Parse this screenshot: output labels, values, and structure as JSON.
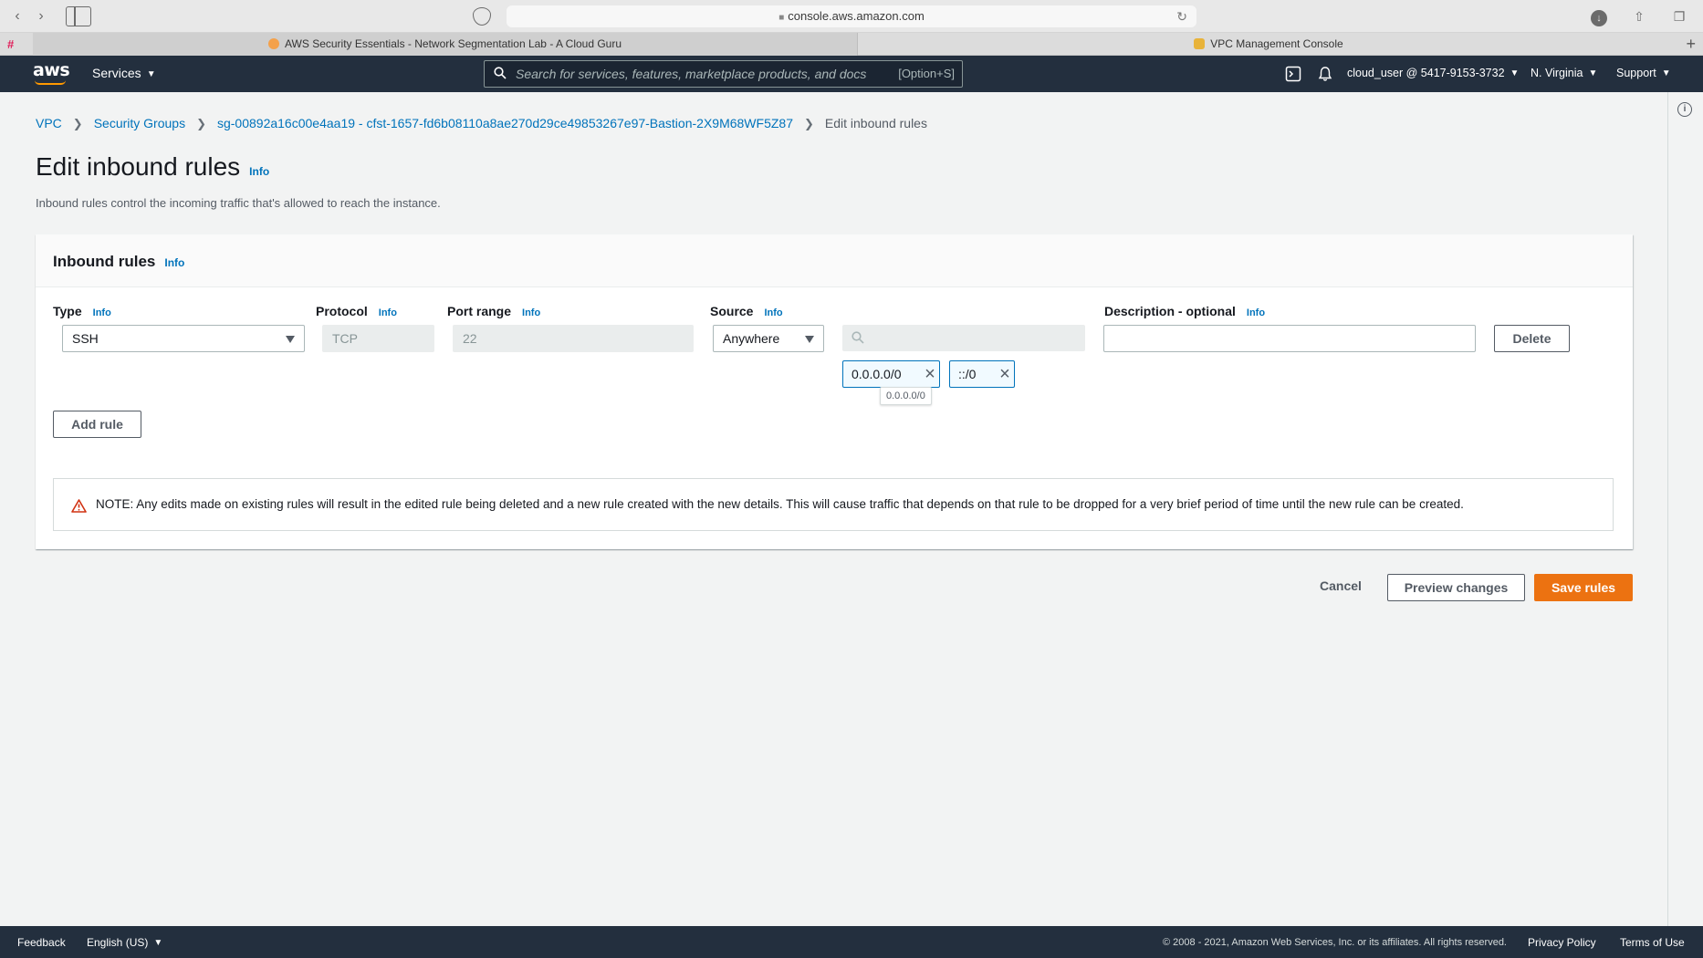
{
  "browser": {
    "url": "console.aws.amazon.com",
    "tabs": [
      {
        "label": "AWS Security Essentials - Network Segmentation Lab - A Cloud Guru"
      },
      {
        "label": "VPC Management Console"
      }
    ]
  },
  "header": {
    "logo": "aws",
    "services": "Services",
    "search_placeholder": "Search for services, features, marketplace products, and docs",
    "search_shortcut": "[Option+S]",
    "account": "cloud_user @ 5417-9153-3732",
    "region": "N. Virginia",
    "support": "Support"
  },
  "breadcrumb": {
    "items": [
      "VPC",
      "Security Groups",
      "sg-00892a16c00e4aa19 - cfst-1657-fd6b08110a8ae270d29ce49853267e97-Bastion-2X9M68WF5Z87"
    ],
    "current": "Edit inbound rules"
  },
  "page": {
    "title": "Edit inbound rules",
    "info": "Info",
    "description": "Inbound rules control the incoming traffic that's allowed to reach the instance."
  },
  "panel": {
    "title": "Inbound rules",
    "info": "Info",
    "columns": {
      "type": "Type",
      "protocol": "Protocol",
      "port_range": "Port range",
      "source": "Source",
      "description": "Description - optional"
    },
    "rule": {
      "type": "SSH",
      "protocol": "TCP",
      "port_range": "22",
      "source": "Anywhere",
      "cidrs": [
        "0.0.0.0/0",
        "::/0"
      ],
      "tooltip": "0.0.0.0/0",
      "description": ""
    },
    "delete_label": "Delete",
    "add_rule_label": "Add rule",
    "note": "NOTE: Any edits made on existing rules will result in the edited rule being deleted and a new rule created with the new details. This will cause traffic that depends on that rule to be dropped for a very brief period of time until the new rule can be created."
  },
  "actions": {
    "cancel": "Cancel",
    "preview": "Preview changes",
    "save": "Save rules"
  },
  "footer": {
    "feedback": "Feedback",
    "language": "English (US)",
    "copyright": "© 2008 - 2021, Amazon Web Services, Inc. or its affiliates. All rights reserved.",
    "privacy": "Privacy Policy",
    "terms": "Terms of Use"
  },
  "colors": {
    "header_bg": "#232f3e",
    "link": "#0073bb",
    "primary": "#ec7211",
    "warning": "#d13212"
  }
}
